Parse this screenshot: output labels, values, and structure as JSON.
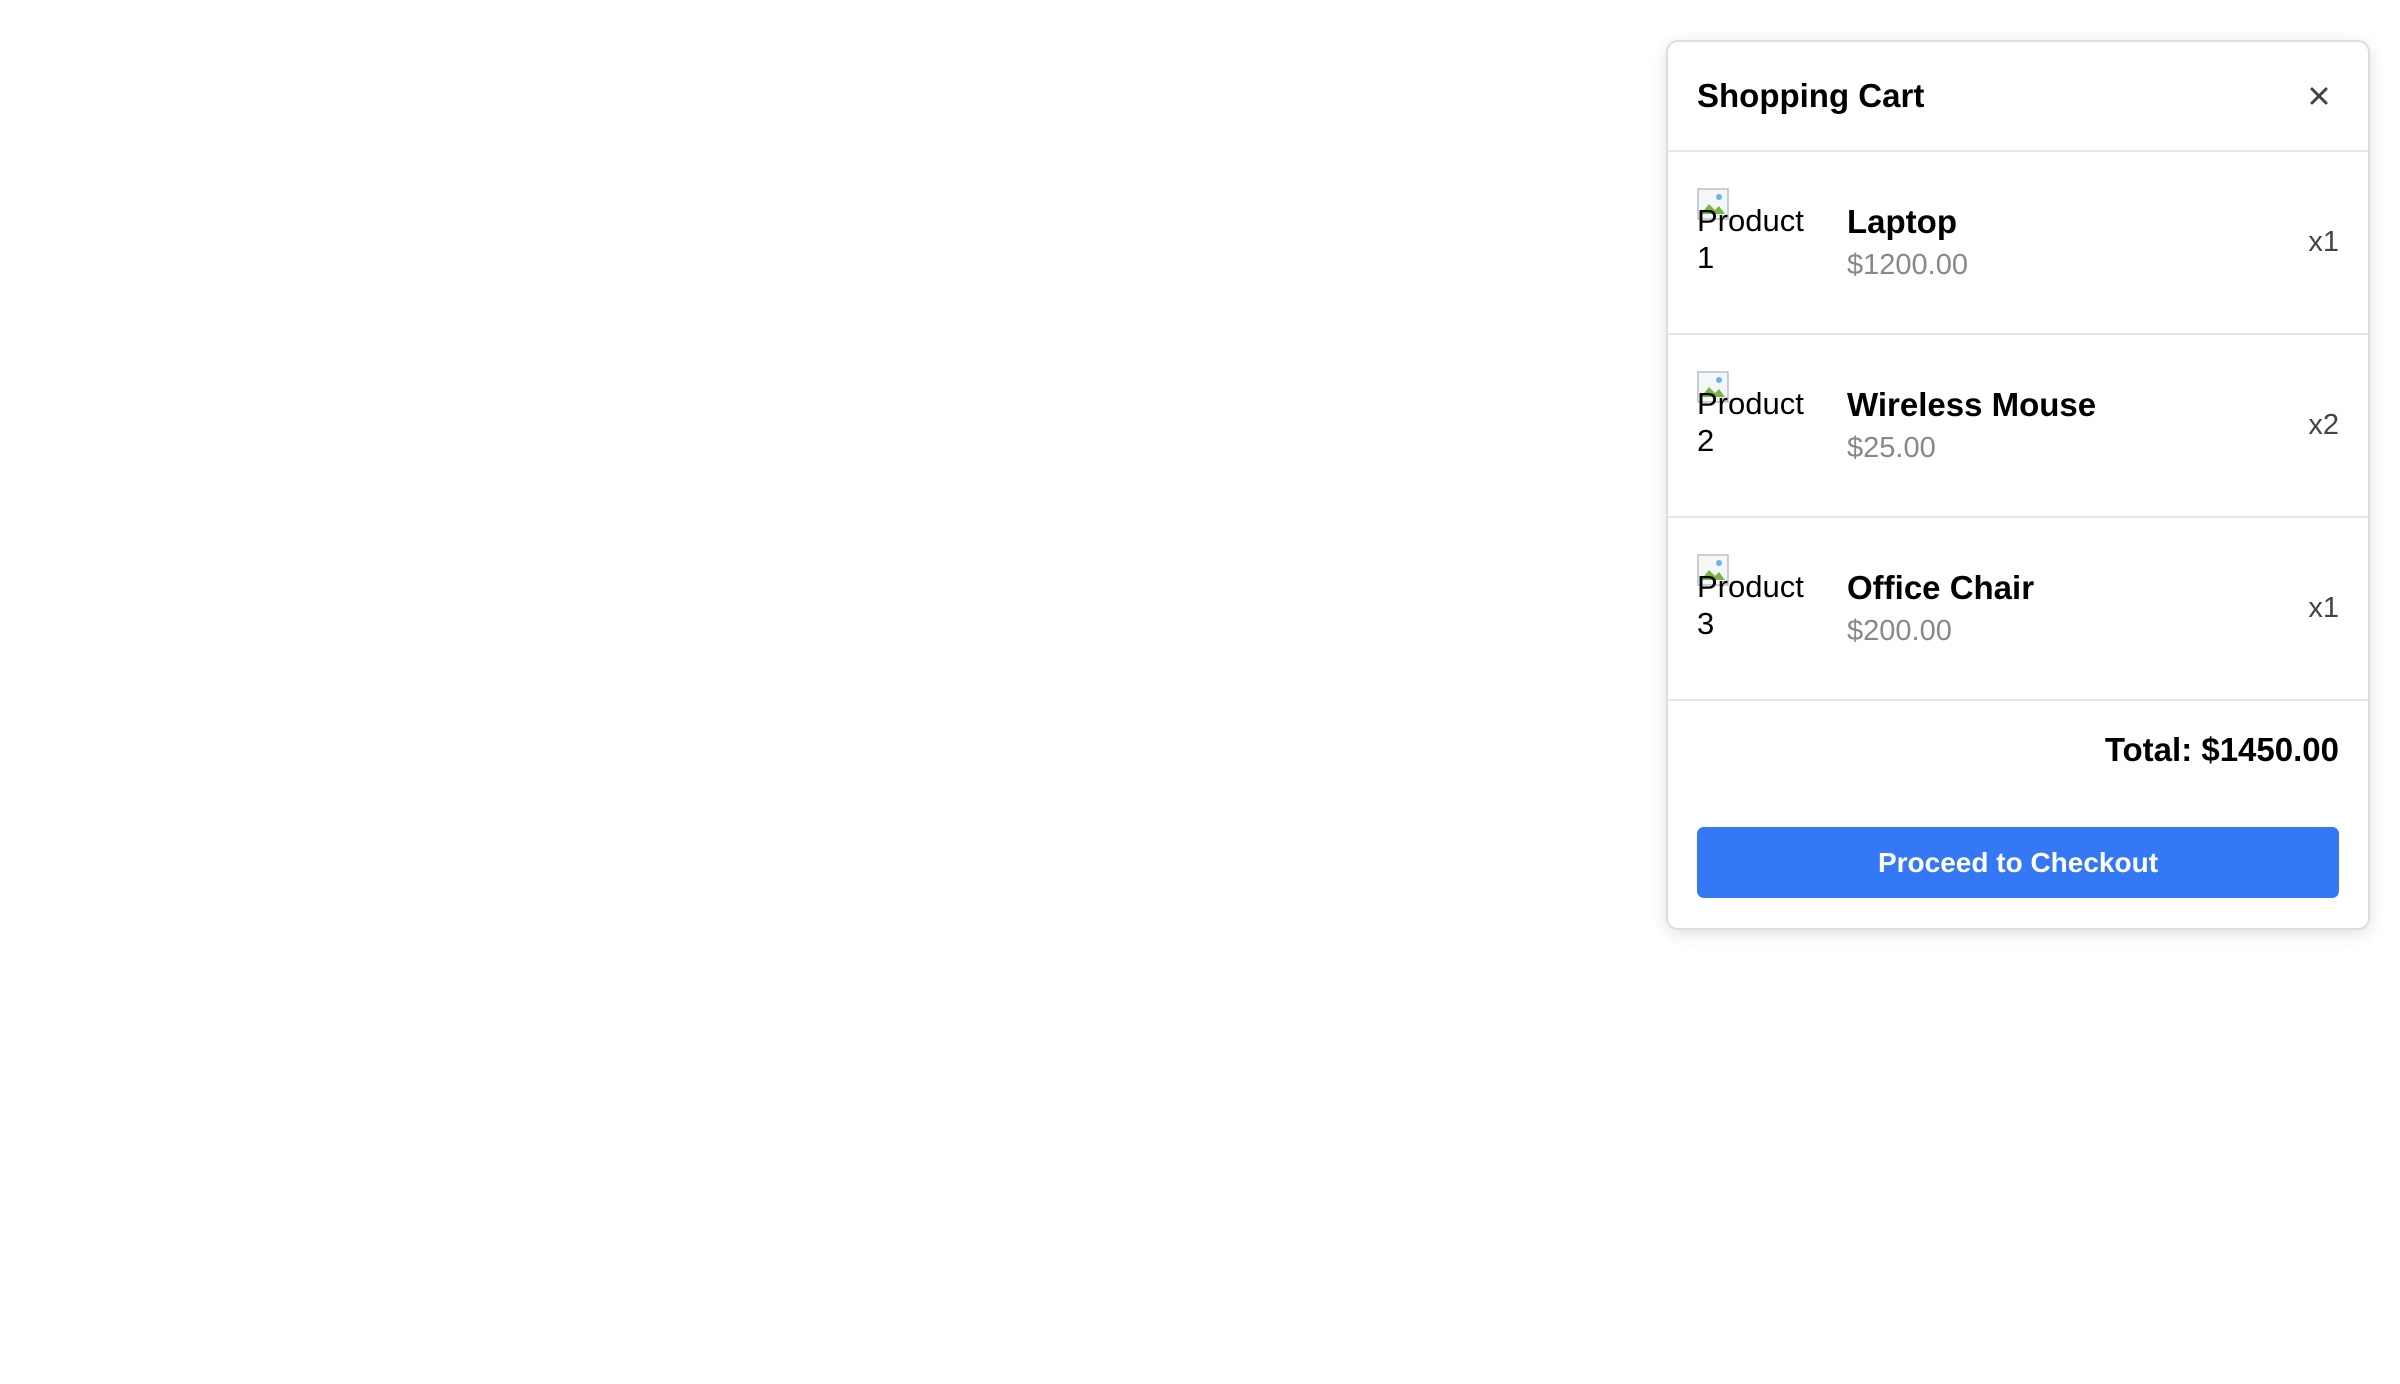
{
  "cart": {
    "title": "Shopping Cart",
    "close_icon": "close-icon",
    "items": [
      {
        "image_alt": "Product 1",
        "name": "Laptop",
        "price": "$1200.00",
        "quantity": "x1"
      },
      {
        "image_alt": "Product 2",
        "name": "Wireless Mouse",
        "price": "$25.00",
        "quantity": "x2"
      },
      {
        "image_alt": "Product 3",
        "name": "Office Chair",
        "price": "$200.00",
        "quantity": "x1"
      }
    ],
    "total_label": "Total: $1450.00",
    "checkout_label": "Proceed to Checkout"
  },
  "colors": {
    "accent": "#3478f6",
    "price_text": "#888888",
    "border": "#dddddd"
  }
}
